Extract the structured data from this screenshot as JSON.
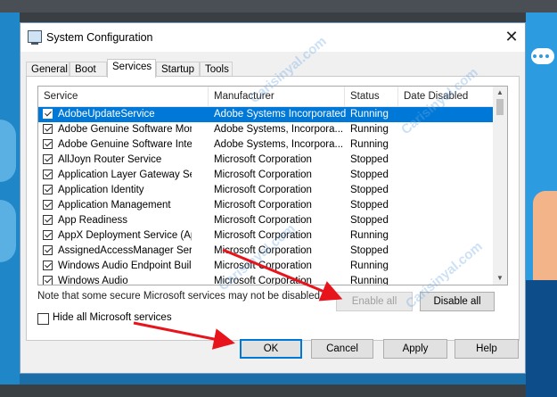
{
  "window": {
    "title": "System Configuration",
    "close_glyph": "✕"
  },
  "tabs": [
    {
      "label": "General",
      "active": false
    },
    {
      "label": "Boot",
      "active": false
    },
    {
      "label": "Services",
      "active": true
    },
    {
      "label": "Startup",
      "active": false
    },
    {
      "label": "Tools",
      "active": false
    }
  ],
  "columns": {
    "service": "Service",
    "manufacturer": "Manufacturer",
    "status": "Status",
    "date_disabled": "Date Disabled"
  },
  "services": [
    {
      "name": "AdobeUpdateService",
      "manufacturer": "Adobe Systems Incorporated",
      "status": "Running",
      "checked": true,
      "selected": true
    },
    {
      "name": "Adobe Genuine Software Monito...",
      "manufacturer": "Adobe Systems, Incorpora...",
      "status": "Running",
      "checked": true
    },
    {
      "name": "Adobe Genuine Software Integri...",
      "manufacturer": "Adobe Systems, Incorpora...",
      "status": "Running",
      "checked": true
    },
    {
      "name": "AllJoyn Router Service",
      "manufacturer": "Microsoft Corporation",
      "status": "Stopped",
      "checked": true
    },
    {
      "name": "Application Layer Gateway Service",
      "manufacturer": "Microsoft Corporation",
      "status": "Stopped",
      "checked": true
    },
    {
      "name": "Application Identity",
      "manufacturer": "Microsoft Corporation",
      "status": "Stopped",
      "checked": true
    },
    {
      "name": "Application Management",
      "manufacturer": "Microsoft Corporation",
      "status": "Stopped",
      "checked": true
    },
    {
      "name": "App Readiness",
      "manufacturer": "Microsoft Corporation",
      "status": "Stopped",
      "checked": true
    },
    {
      "name": "AppX Deployment Service (AppX...",
      "manufacturer": "Microsoft Corporation",
      "status": "Running",
      "checked": true
    },
    {
      "name": "AssignedAccessManager Service",
      "manufacturer": "Microsoft Corporation",
      "status": "Stopped",
      "checked": true
    },
    {
      "name": "Windows Audio Endpoint Builder",
      "manufacturer": "Microsoft Corporation",
      "status": "Running",
      "checked": true
    },
    {
      "name": "Windows Audio",
      "manufacturer": "Microsoft Corporation",
      "status": "Running",
      "checked": true
    }
  ],
  "note": "Note that some secure Microsoft services may not be disabled.",
  "buttons": {
    "enable_all": "Enable all",
    "disable_all": "Disable all",
    "ok": "OK",
    "cancel": "Cancel",
    "apply": "Apply",
    "help": "Help"
  },
  "hide_microsoft": {
    "label": "Hide all Microsoft services",
    "checked": false
  },
  "watermark": "Carisinyal.com",
  "colors": {
    "selection": "#0078d7",
    "arrow": "#e8141b",
    "watermark": "#6eaae1"
  }
}
